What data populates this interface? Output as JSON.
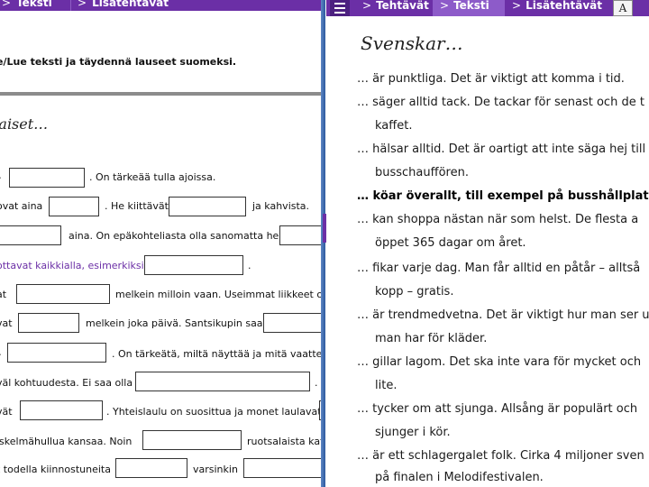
{
  "left": {
    "tabs": [
      {
        "label": "Tekstí"
      },
      {
        "label": "Lisätehtävät"
      }
    ],
    "instruction": "e/Lue teksti ja täydennä lauseet suomeksi.",
    "heading": "'aiset…",
    "rows": [
      {
        "pre": "–",
        "mid": ". On tärkeää tulla ajoissa.",
        "end": ""
      },
      {
        "pre": "ovat aina",
        "mid": ". He kiittävät",
        "end": "ja kahvista."
      },
      {
        "pre": "",
        "mid": "aina. On epäkohteliasta olla sanomatta hei",
        "end": ""
      },
      {
        "pre": "ottavat kaikkialla, esimerkiksi",
        "mid": ".",
        "end": ""
      },
      {
        "pre": "at",
        "mid": "melkein milloin vaan. Useimmat liikkeet ov",
        "end": ""
      },
      {
        "pre": "vat",
        "mid": "melkein joka päivä. Santsikupin saa",
        "end": ""
      },
      {
        "pre": "–",
        "mid": ". On tärkeätä, miltä näyttää ja mitä vaatteita",
        "end": ""
      },
      {
        "pre": "väl kohtuudesta. Ei saa olla",
        "mid": ".",
        "end": ""
      },
      {
        "pre": "vät",
        "mid": ". Yhteislaulu on suosittua ja monet laulavat",
        "end": ""
      },
      {
        "pre": "iskelmähullua kansaa. Noin",
        "mid": "ruotsalaista kat",
        "end": ""
      },
      {
        "pre": "t todella kiinnostuneita",
        "mid": "varsinkin",
        "end": ""
      }
    ]
  },
  "right": {
    "tabs": [
      {
        "label": "Tehtävät"
      },
      {
        "label": "Teksti"
      },
      {
        "label": "Lisätehtävät"
      }
    ],
    "dictionary_icon_letter": "A",
    "title": "Svenskar…",
    "lines": [
      "… är punktliga. Det är viktigt att komma i tid.",
      "… säger alltid tack. De tackar för senast och de t",
      "kaffet.",
      "… hälsar alltid. Det är oartigt att inte säga hej till",
      "busschauffören.",
      "… köar överallt, till exempel på busshållplatser.",
      "… kan shoppa nästan när som helst. De flesta a",
      "öppet 365 dagar om året.",
      "… fikar varje dag. Man får alltid en påtår – alltså",
      "kopp – gratis.",
      "… är trendmedvetna. Det är viktigt hur man ser u",
      "man har för kläder.",
      "… gillar lagom. Det ska inte vara för mycket och",
      "lite.",
      "… tycker om att sjunga. Allsång är populärt och",
      "sjunger i kör.",
      "… är ett schlagergalet folk. Cirka 4 miljoner sven",
      "på finalen i Melodifestivalen."
    ]
  },
  "colors": {
    "tab_purple": "#6b2fa6",
    "active_tab": "#8d5bc9",
    "window_border": "#2d5a9f"
  }
}
